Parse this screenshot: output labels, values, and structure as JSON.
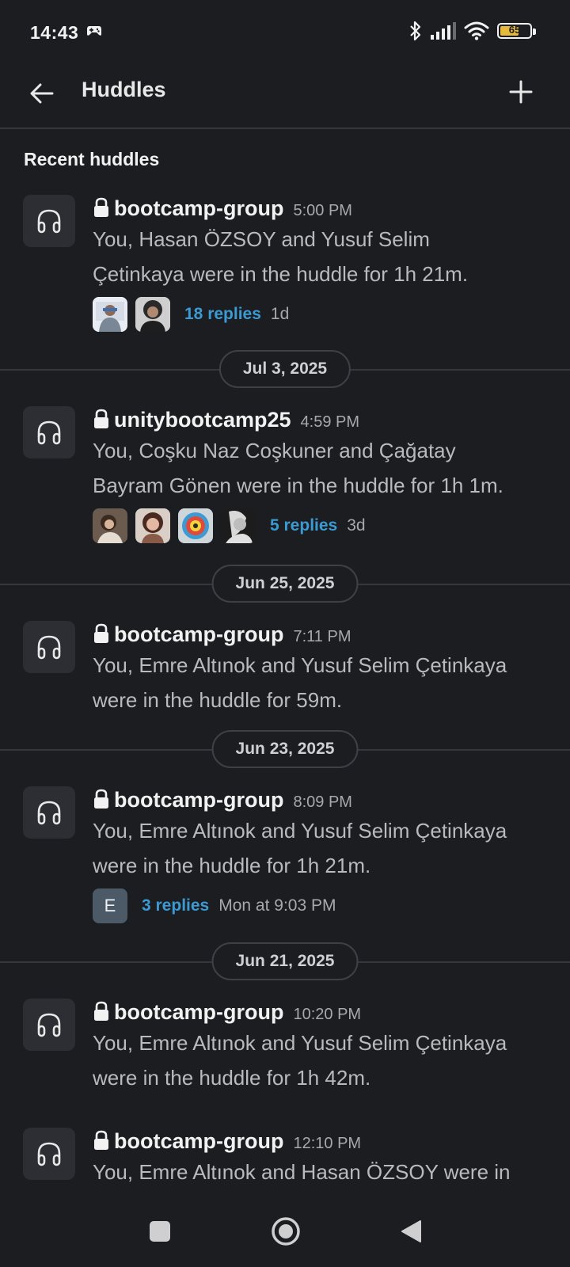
{
  "status_bar": {
    "time": "14:43",
    "battery": "65",
    "icons": [
      "gamepad-icon",
      "bluetooth-icon",
      "signal-icon",
      "wifi-icon",
      "battery-icon"
    ]
  },
  "header": {
    "title": "Huddles",
    "back_icon": "arrow-left-icon",
    "add_icon": "plus-icon"
  },
  "section_title": "Recent huddles",
  "huddles": [
    {
      "channel": "bootcamp-group",
      "time": "5:00 PM",
      "desc_line1": "You, Hasan ÖZSOY and Yusuf Selim",
      "desc_line2": "Çetinkaya were in the huddle for 1h 21m.",
      "replies": "18 replies",
      "replies_time": "1d"
    },
    {
      "channel": "unitybootcamp25",
      "time": "4:59 PM",
      "desc_line1": "You, Coşku Naz Coşkuner and Çağatay",
      "desc_line2": "Bayram Gönen were in the huddle for 1h 1m.",
      "replies": "5 replies",
      "replies_time": "3d"
    },
    {
      "channel": "bootcamp-group",
      "time": "7:11 PM",
      "desc_line1": "You, Emre Altınok and Yusuf Selim Çetinkaya",
      "desc_line2": "were in the huddle for 59m."
    },
    {
      "channel": "bootcamp-group",
      "time": "8:09 PM",
      "desc_line1": "You, Emre Altınok and Yusuf Selim Çetinkaya",
      "desc_line2": "were in the huddle for 1h 21m.",
      "avatar_letter": "E",
      "replies": "3 replies",
      "replies_time": "Mon at 9:03 PM"
    },
    {
      "channel": "bootcamp-group",
      "time": "10:20 PM",
      "desc_line1": "You, Emre Altınok and Yusuf Selim Çetinkaya",
      "desc_line2": "were in the huddle for 1h 42m."
    },
    {
      "channel": "bootcamp-group",
      "time": "12:10 PM",
      "desc_line1": "You, Emre Altınok and Hasan ÖZSOY were in"
    }
  ],
  "dates": [
    "Jul 3, 2025",
    "Jun 25, 2025",
    "Jun 23, 2025",
    "Jun 21, 2025"
  ],
  "nav": {
    "icons": [
      "recents-square-icon",
      "home-circle-icon",
      "back-triangle-icon"
    ]
  }
}
